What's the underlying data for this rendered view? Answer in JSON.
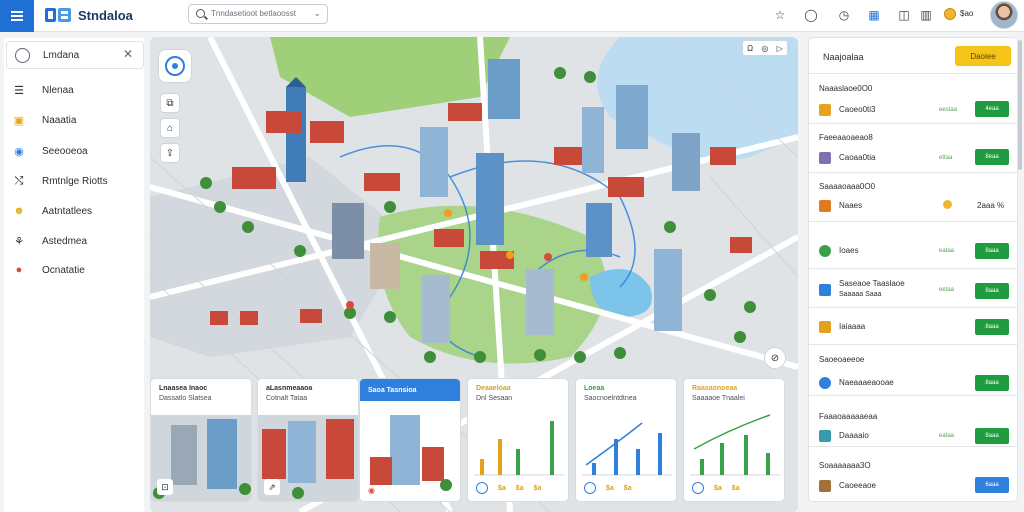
{
  "app": {
    "title": "Stndaloa"
  },
  "search": {
    "text": "Tnndasetioot betlaoosst"
  },
  "topbar": {
    "coin_value": "$ao"
  },
  "sidebar": {
    "header": "Lmdana",
    "items": [
      {
        "label": "Nlenaa",
        "icon": "list-icon"
      },
      {
        "label": "Naaatia",
        "icon": "calendar-icon"
      },
      {
        "label": "Seeooeoa",
        "icon": "globe-icon"
      },
      {
        "label": "Rmtnlge Riotts",
        "icon": "routes-icon"
      },
      {
        "label": "Aatntatlees",
        "icon": "people-icon"
      },
      {
        "label": "Astedmea",
        "icon": "chart-icon"
      },
      {
        "label": "Ocnatatie",
        "icon": "pin-icon"
      }
    ]
  },
  "map": {
    "top_right": [
      "Ω",
      "◎",
      "▷"
    ]
  },
  "cards": [
    {
      "title": "Lnaasea Inaoc",
      "subtitle": "Dassatlo Slatsea"
    },
    {
      "title": "aLasnmeaaoa",
      "subtitle": "Cotnalt Tataa"
    },
    {
      "title": "Saoa Tasnsioa"
    },
    {
      "title": "Deaaeloaa",
      "subtitle": "Dnl Sesaan",
      "foot": [
        "$a",
        "$a",
        "$a"
      ]
    },
    {
      "title": "Loeaa",
      "subtitle": "Saocnoelntdtnea",
      "foot": [
        "$a",
        "$a"
      ]
    },
    {
      "title": "Raasaonoeaa",
      "subtitle": "Saaaaoe Tnaalei",
      "foot": [
        "$a",
        "$a"
      ]
    }
  ],
  "panel": {
    "title": "Naajoalaa",
    "header_button": "Daoiee",
    "rows": [
      {
        "section": "Naaaslaoe0O0",
        "name": "Caoeo0ti3",
        "meta": "eestaa",
        "button": "4eaa",
        "icon_color": "#e8a21e"
      },
      {
        "section": "Faeeaaoaeao8",
        "name": "Caoaa0tia",
        "meta": "ettaa",
        "button": "8eaa",
        "icon_color": "#8070b0"
      },
      {
        "section": "Saaaaoaaa0O0",
        "name": "Naaes",
        "meta": "",
        "button": "2aaa %",
        "icon_color": "#e07a20"
      },
      {
        "section": "",
        "name": "Ioaes",
        "meta": "eataa",
        "button": "8aaa",
        "icon_color": "#3aa04a"
      },
      {
        "section": "",
        "name": "Saseaoe Taaslaoe",
        "name2": "Saaaaa Saaa",
        "meta": "eetaa",
        "button": "8aaa",
        "icon_color": "#2f80dd"
      },
      {
        "section": "",
        "name": "Iaiaaaa",
        "meta": "",
        "button": "8aaa",
        "icon_color": "#e0a020"
      },
      {
        "section": "Saoeoaeeoe",
        "name": "Naeaaaeaooae",
        "meta": "",
        "button": "8aaa",
        "icon_color": "#2f80dd"
      },
      {
        "section": "Faaaoaaaaaeaa",
        "name": "Daaaaio",
        "meta": "eataa",
        "button": "8aaa",
        "icon_color": "#3a9ab0"
      },
      {
        "section": "Soaaaaaaa3O",
        "name": "Caoeeaoe",
        "meta": "",
        "button": "6aaa",
        "icon_color": "#a0703a",
        "blue": true
      }
    ]
  }
}
